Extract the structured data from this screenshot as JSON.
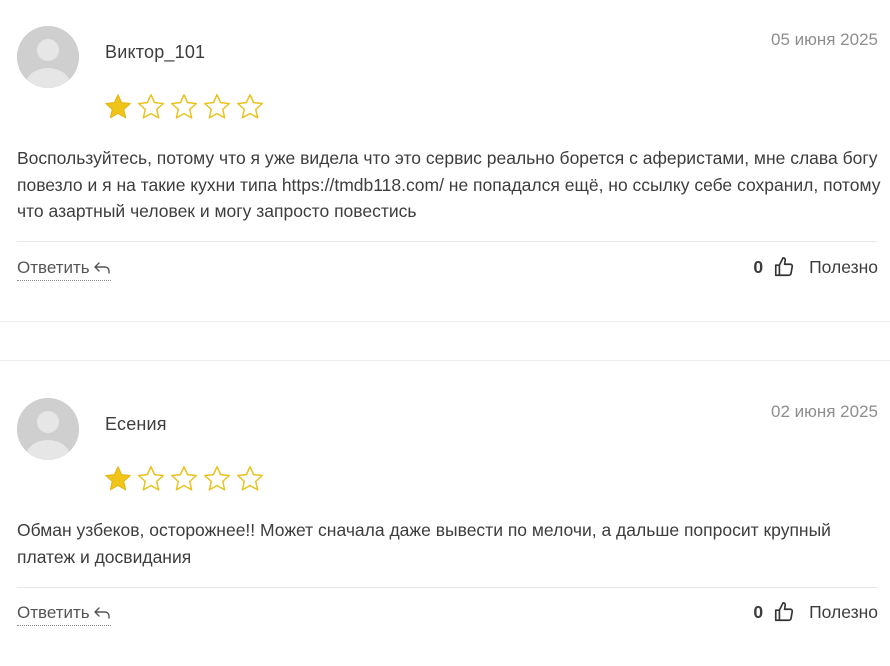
{
  "reviews": [
    {
      "author": "Виктор_101",
      "date": "05 июня 2025",
      "rating": 1,
      "max_rating": 5,
      "text": "Воспользуйтесь, потому что я уже видела что это сервис реально борется с аферистами, мне слава богу повезло и я на такие кухни типа https://tmdb118.com/ не попадался ещё, но ссылку себе сохранил, потому что азартный человек и могу запросто повестись",
      "reply_label": "Ответить",
      "useful_count": "0",
      "useful_label": "Полезно"
    },
    {
      "author": "Есения",
      "date": "02 июня 2025",
      "rating": 1,
      "max_rating": 5,
      "text": "Обман узбеков, осторожнее!! Может сначала даже вывести по мелочи, а дальше попросит крупный платеж и досвидания",
      "reply_label": "Ответить",
      "useful_count": "0",
      "useful_label": "Полезно"
    }
  ],
  "colors": {
    "star_filled": "#f0c419",
    "star_outline": "#e9c21e",
    "avatar_bg": "#d0d0d0",
    "date_text": "#8e8e8e",
    "body_text": "#3d3d3d"
  },
  "icons": {
    "avatar": "user-avatar-icon",
    "star": "star-icon",
    "reply": "reply-arrow-icon",
    "like": "thumbs-up-icon"
  }
}
